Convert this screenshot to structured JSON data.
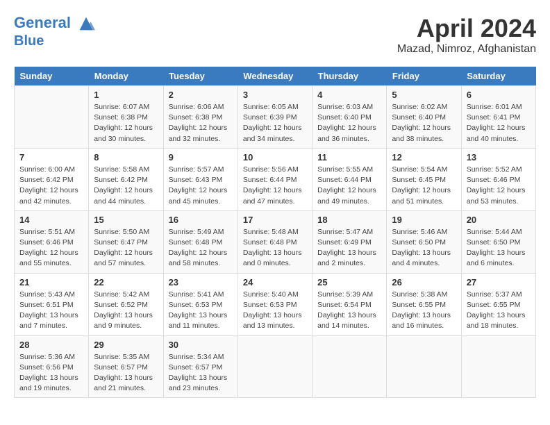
{
  "header": {
    "logo_line1": "General",
    "logo_line2": "Blue",
    "month_title": "April 2024",
    "location": "Mazad, Nimroz, Afghanistan"
  },
  "weekdays": [
    "Sunday",
    "Monday",
    "Tuesday",
    "Wednesday",
    "Thursday",
    "Friday",
    "Saturday"
  ],
  "weeks": [
    [
      {
        "day": "",
        "info": ""
      },
      {
        "day": "1",
        "info": "Sunrise: 6:07 AM\nSunset: 6:38 PM\nDaylight: 12 hours\nand 30 minutes."
      },
      {
        "day": "2",
        "info": "Sunrise: 6:06 AM\nSunset: 6:38 PM\nDaylight: 12 hours\nand 32 minutes."
      },
      {
        "day": "3",
        "info": "Sunrise: 6:05 AM\nSunset: 6:39 PM\nDaylight: 12 hours\nand 34 minutes."
      },
      {
        "day": "4",
        "info": "Sunrise: 6:03 AM\nSunset: 6:40 PM\nDaylight: 12 hours\nand 36 minutes."
      },
      {
        "day": "5",
        "info": "Sunrise: 6:02 AM\nSunset: 6:40 PM\nDaylight: 12 hours\nand 38 minutes."
      },
      {
        "day": "6",
        "info": "Sunrise: 6:01 AM\nSunset: 6:41 PM\nDaylight: 12 hours\nand 40 minutes."
      }
    ],
    [
      {
        "day": "7",
        "info": "Sunrise: 6:00 AM\nSunset: 6:42 PM\nDaylight: 12 hours\nand 42 minutes."
      },
      {
        "day": "8",
        "info": "Sunrise: 5:58 AM\nSunset: 6:42 PM\nDaylight: 12 hours\nand 44 minutes."
      },
      {
        "day": "9",
        "info": "Sunrise: 5:57 AM\nSunset: 6:43 PM\nDaylight: 12 hours\nand 45 minutes."
      },
      {
        "day": "10",
        "info": "Sunrise: 5:56 AM\nSunset: 6:44 PM\nDaylight: 12 hours\nand 47 minutes."
      },
      {
        "day": "11",
        "info": "Sunrise: 5:55 AM\nSunset: 6:44 PM\nDaylight: 12 hours\nand 49 minutes."
      },
      {
        "day": "12",
        "info": "Sunrise: 5:54 AM\nSunset: 6:45 PM\nDaylight: 12 hours\nand 51 minutes."
      },
      {
        "day": "13",
        "info": "Sunrise: 5:52 AM\nSunset: 6:46 PM\nDaylight: 12 hours\nand 53 minutes."
      }
    ],
    [
      {
        "day": "14",
        "info": "Sunrise: 5:51 AM\nSunset: 6:46 PM\nDaylight: 12 hours\nand 55 minutes."
      },
      {
        "day": "15",
        "info": "Sunrise: 5:50 AM\nSunset: 6:47 PM\nDaylight: 12 hours\nand 57 minutes."
      },
      {
        "day": "16",
        "info": "Sunrise: 5:49 AM\nSunset: 6:48 PM\nDaylight: 12 hours\nand 58 minutes."
      },
      {
        "day": "17",
        "info": "Sunrise: 5:48 AM\nSunset: 6:48 PM\nDaylight: 13 hours\nand 0 minutes."
      },
      {
        "day": "18",
        "info": "Sunrise: 5:47 AM\nSunset: 6:49 PM\nDaylight: 13 hours\nand 2 minutes."
      },
      {
        "day": "19",
        "info": "Sunrise: 5:46 AM\nSunset: 6:50 PM\nDaylight: 13 hours\nand 4 minutes."
      },
      {
        "day": "20",
        "info": "Sunrise: 5:44 AM\nSunset: 6:50 PM\nDaylight: 13 hours\nand 6 minutes."
      }
    ],
    [
      {
        "day": "21",
        "info": "Sunrise: 5:43 AM\nSunset: 6:51 PM\nDaylight: 13 hours\nand 7 minutes."
      },
      {
        "day": "22",
        "info": "Sunrise: 5:42 AM\nSunset: 6:52 PM\nDaylight: 13 hours\nand 9 minutes."
      },
      {
        "day": "23",
        "info": "Sunrise: 5:41 AM\nSunset: 6:53 PM\nDaylight: 13 hours\nand 11 minutes."
      },
      {
        "day": "24",
        "info": "Sunrise: 5:40 AM\nSunset: 6:53 PM\nDaylight: 13 hours\nand 13 minutes."
      },
      {
        "day": "25",
        "info": "Sunrise: 5:39 AM\nSunset: 6:54 PM\nDaylight: 13 hours\nand 14 minutes."
      },
      {
        "day": "26",
        "info": "Sunrise: 5:38 AM\nSunset: 6:55 PM\nDaylight: 13 hours\nand 16 minutes."
      },
      {
        "day": "27",
        "info": "Sunrise: 5:37 AM\nSunset: 6:55 PM\nDaylight: 13 hours\nand 18 minutes."
      }
    ],
    [
      {
        "day": "28",
        "info": "Sunrise: 5:36 AM\nSunset: 6:56 PM\nDaylight: 13 hours\nand 19 minutes."
      },
      {
        "day": "29",
        "info": "Sunrise: 5:35 AM\nSunset: 6:57 PM\nDaylight: 13 hours\nand 21 minutes."
      },
      {
        "day": "30",
        "info": "Sunrise: 5:34 AM\nSunset: 6:57 PM\nDaylight: 13 hours\nand 23 minutes."
      },
      {
        "day": "",
        "info": ""
      },
      {
        "day": "",
        "info": ""
      },
      {
        "day": "",
        "info": ""
      },
      {
        "day": "",
        "info": ""
      }
    ]
  ]
}
